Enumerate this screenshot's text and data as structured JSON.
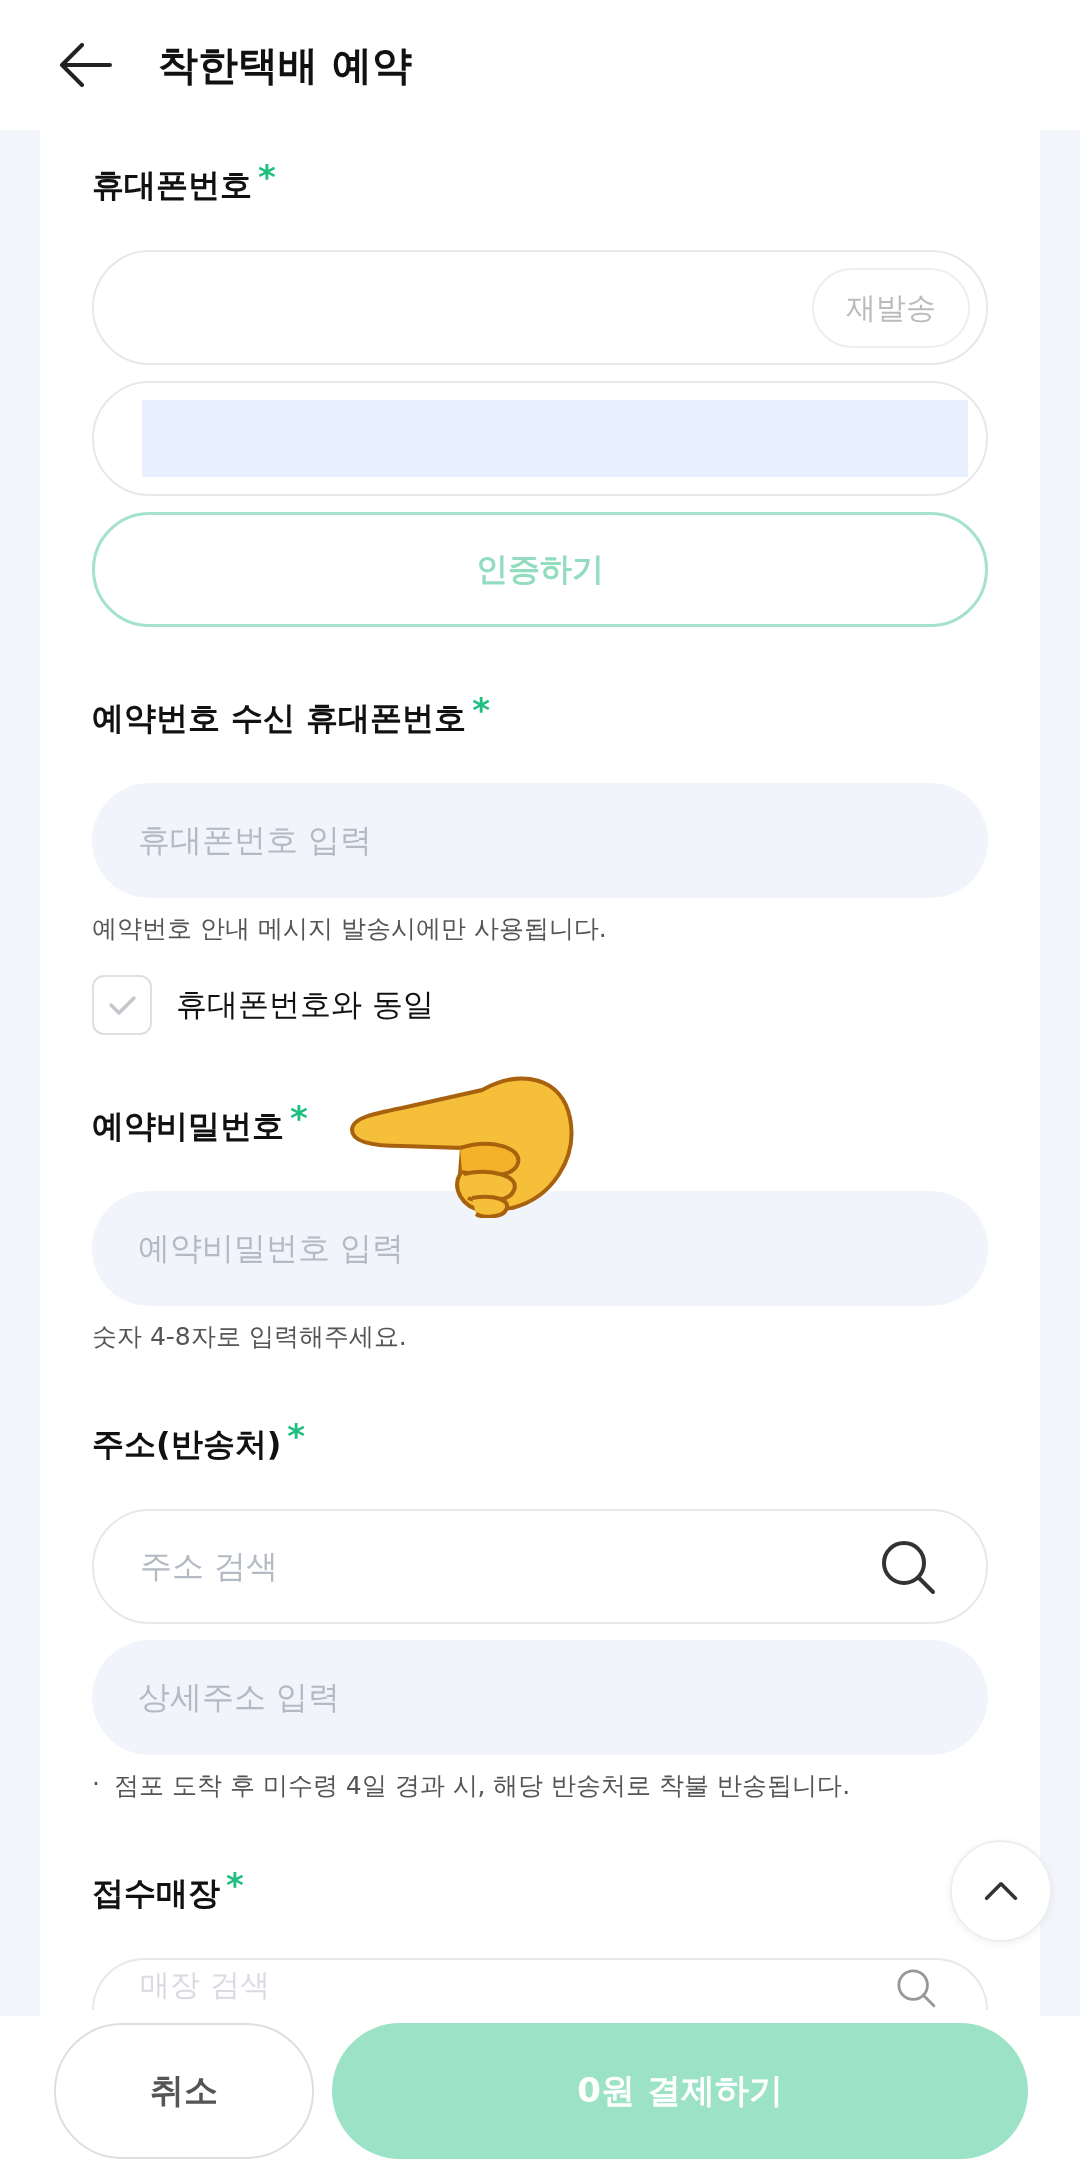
{
  "header": {
    "title": "착한택배 예약"
  },
  "sections": [
    {
      "label": "휴대폰번호",
      "asterisk": "*",
      "items": [
        {
          "kind": "field",
          "action": "재발송"
        },
        {
          "kind": "autofill-field"
        },
        {
          "kind": "button",
          "label": "인증하기",
          "disabled": true
        }
      ]
    },
    {
      "label": "예약번호 수신 휴대폰번호",
      "asterisk": "*",
      "items": [
        {
          "kind": "filled-field",
          "placeholder": "휴대폰번호 입력"
        },
        {
          "kind": "note",
          "text": "예약번호 안내 메시지 발송시에만 사용됩니다."
        },
        {
          "kind": "checkbox",
          "label": "휴대폰번호와 동일",
          "checked": false
        }
      ]
    },
    {
      "label": "예약비밀번호",
      "asterisk": "*",
      "items": [
        {
          "kind": "filled-field",
          "placeholder": "예약비밀번호 입력"
        },
        {
          "kind": "note",
          "text": "숫자 4-8자로 입력해주세요."
        }
      ]
    },
    {
      "label": "주소(반송처)",
      "asterisk": "*",
      "items": [
        {
          "kind": "search-field",
          "placeholder": "주소 검색"
        },
        {
          "kind": "filled-field",
          "placeholder": "상세주소 입력"
        },
        {
          "kind": "note",
          "bullet": "·",
          "text": "점포 도착 후 미수령 4일 경과 시, 해당 반송처로 착불 반송됩니다."
        }
      ]
    },
    {
      "label": "접수매장",
      "asterisk": "*",
      "items": [
        {
          "kind": "cut-search-field",
          "placeholder": "매장 검색"
        }
      ]
    }
  ],
  "footer": {
    "cancel": "취소",
    "pay": "0원 결제하기",
    "pay_disabled": true
  }
}
